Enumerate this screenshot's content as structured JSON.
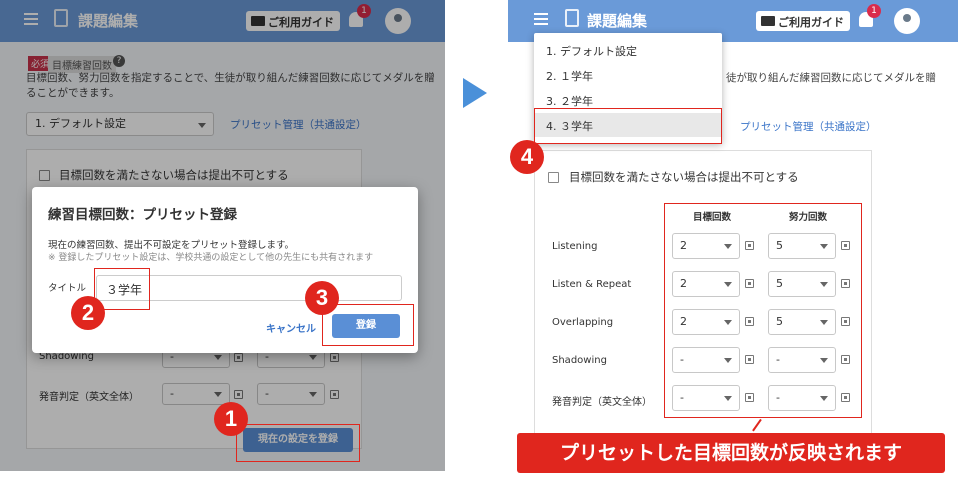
{
  "app": {
    "title": "課題編集",
    "guide_label": "ご利用ガイド",
    "notification_count": "1"
  },
  "field": {
    "required_badge": "必須",
    "title": "目標練習回数",
    "help": "?"
  },
  "description": {
    "line1": "目標回数、努力回数を指定することで、生徒が取り組んだ練習回数に応じてメダルを贈",
    "line2": "ることができます。",
    "right_line1": "徒が取り組んだ練習回数に応じてメダルを贈"
  },
  "preset": {
    "selected": "1. デフォルト設定",
    "manage_link": "プリセット管理（共通設定）"
  },
  "checkbox": {
    "label": "目標回数を満たさない場合は提出不可とする"
  },
  "modal": {
    "title": "練習目標回数：プリセット登録",
    "text1": "現在の練習回数、提出不可設定をプリセット登録します。",
    "text2": "※ 登録したプリセット設定は、学校共通の設定として他の先生にも共有されます",
    "title_label": "タイトル",
    "title_value": "３学年",
    "cancel": "キャンセル",
    "register": "登録"
  },
  "left_rows": [
    {
      "label": "Shadowing",
      "target": "-",
      "effort": "-"
    },
    {
      "label": "発音判定（英文全体）",
      "target": "-",
      "effort": "-"
    }
  ],
  "save_button": "現在の設定を登録",
  "dropdown": [
    "1. デフォルト設定",
    "2. １学年",
    "3. ２学年",
    "4. ３学年"
  ],
  "table": {
    "col_target": "目標回数",
    "col_effort": "努力回数",
    "rows": [
      {
        "label": "Listening",
        "target": "2",
        "effort": "5"
      },
      {
        "label": "Listen & Repeat",
        "target": "2",
        "effort": "5"
      },
      {
        "label": "Overlapping",
        "target": "2",
        "effort": "5"
      },
      {
        "label": "Shadowing",
        "target": "-",
        "effort": "-"
      },
      {
        "label": "発音判定（英文全体）",
        "target": "-",
        "effort": "-"
      }
    ]
  },
  "steps": [
    "1",
    "2",
    "3",
    "4"
  ],
  "banner": "プリセットした目標回数が反映されます",
  "colors": {
    "appbar": "#6a9ad8",
    "accent_red": "#e0261e",
    "link": "#3a74c8",
    "button_blue": "#5a8fd6"
  }
}
